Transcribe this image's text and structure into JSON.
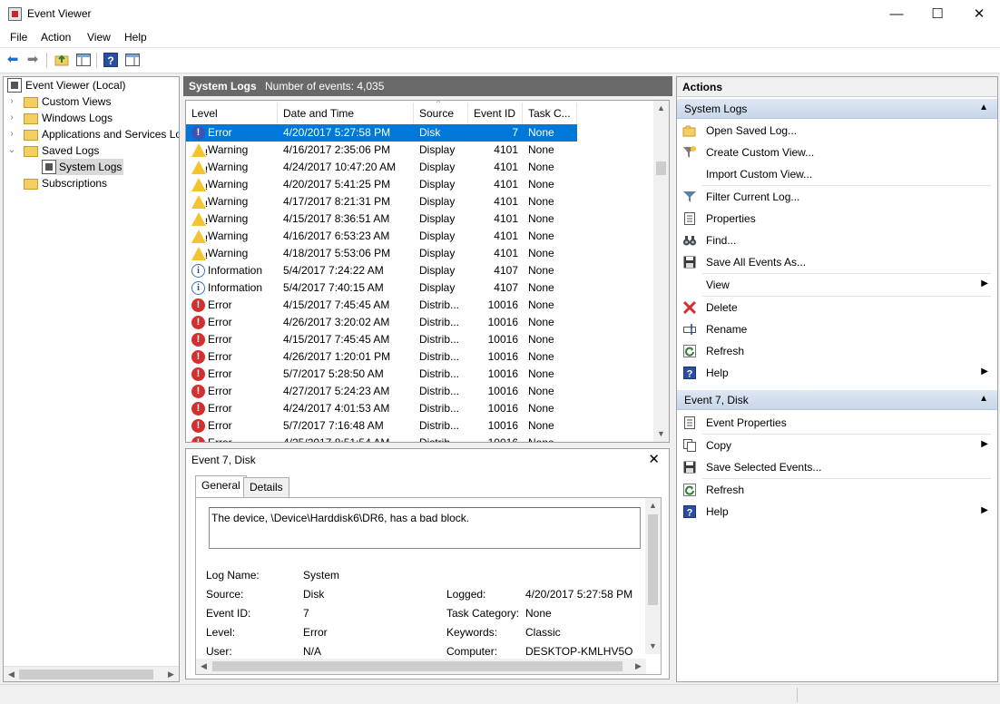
{
  "window": {
    "title": "Event Viewer",
    "minimize_glyph": "—",
    "maximize_glyph": "☐",
    "close_glyph": "✕"
  },
  "menu": [
    "File",
    "Action",
    "View",
    "Help"
  ],
  "toolbar": {
    "icons": [
      "back-arrow-icon",
      "forward-arrow-icon",
      "up-folder-icon",
      "show-hide-tree-icon",
      "help-icon",
      "show-hide-action-pane-icon"
    ]
  },
  "tree": {
    "root": "Event Viewer (Local)",
    "items": [
      {
        "label": "Custom Views"
      },
      {
        "label": "Windows Logs"
      },
      {
        "label": "Applications and Services Lo"
      },
      {
        "label": "Saved Logs"
      },
      {
        "label": "System Logs"
      },
      {
        "label": "Subscriptions"
      }
    ]
  },
  "log_header": {
    "title": "System Logs",
    "count": "Number of events: 4,035"
  },
  "grid": {
    "columns": [
      "Level",
      "Date and Time",
      "Source",
      "Event ID",
      "Task C..."
    ],
    "rows": [
      {
        "level": "Error",
        "date": "4/20/2017 5:27:58 PM",
        "source": "Disk",
        "event_id": "7",
        "task": "None"
      },
      {
        "level": "Warning",
        "date": "4/16/2017 2:35:06 PM",
        "source": "Display",
        "event_id": "4101",
        "task": "None"
      },
      {
        "level": "Warning",
        "date": "4/24/2017 10:47:20 AM",
        "source": "Display",
        "event_id": "4101",
        "task": "None"
      },
      {
        "level": "Warning",
        "date": "4/20/2017 5:41:25 PM",
        "source": "Display",
        "event_id": "4101",
        "task": "None"
      },
      {
        "level": "Warning",
        "date": "4/17/2017 8:21:31 PM",
        "source": "Display",
        "event_id": "4101",
        "task": "None"
      },
      {
        "level": "Warning",
        "date": "4/15/2017 8:36:51 AM",
        "source": "Display",
        "event_id": "4101",
        "task": "None"
      },
      {
        "level": "Warning",
        "date": "4/16/2017 6:53:23 AM",
        "source": "Display",
        "event_id": "4101",
        "task": "None"
      },
      {
        "level": "Warning",
        "date": "4/18/2017 5:53:06 PM",
        "source": "Display",
        "event_id": "4101",
        "task": "None"
      },
      {
        "level": "Information",
        "date": "5/4/2017 7:24:22 AM",
        "source": "Display",
        "event_id": "4107",
        "task": "None"
      },
      {
        "level": "Information",
        "date": "5/4/2017 7:40:15 AM",
        "source": "Display",
        "event_id": "4107",
        "task": "None"
      },
      {
        "level": "Error",
        "date": "4/15/2017 7:45:45 AM",
        "source": "Distrib...",
        "event_id": "10016",
        "task": "None"
      },
      {
        "level": "Error",
        "date": "4/26/2017 3:20:02 AM",
        "source": "Distrib...",
        "event_id": "10016",
        "task": "None"
      },
      {
        "level": "Error",
        "date": "4/15/2017 7:45:45 AM",
        "source": "Distrib...",
        "event_id": "10016",
        "task": "None"
      },
      {
        "level": "Error",
        "date": "4/26/2017 1:20:01 PM",
        "source": "Distrib...",
        "event_id": "10016",
        "task": "None"
      },
      {
        "level": "Error",
        "date": "5/7/2017 5:28:50 AM",
        "source": "Distrib...",
        "event_id": "10016",
        "task": "None"
      },
      {
        "level": "Error",
        "date": "4/27/2017 5:24:23 AM",
        "source": "Distrib...",
        "event_id": "10016",
        "task": "None"
      },
      {
        "level": "Error",
        "date": "4/24/2017 4:01:53 AM",
        "source": "Distrib...",
        "event_id": "10016",
        "task": "None"
      },
      {
        "level": "Error",
        "date": "5/7/2017 7:16:48 AM",
        "source": "Distrib...",
        "event_id": "10016",
        "task": "None"
      },
      {
        "level": "Error",
        "date": "4/25/2017 8:51:54 AM",
        "source": "Distrib...",
        "event_id": "10016",
        "task": "None"
      }
    ]
  },
  "details": {
    "title": "Event 7, Disk",
    "close_glyph": "✕",
    "tabs": [
      "General",
      "Details"
    ],
    "message": "The device, \\Device\\Harddisk6\\DR6, has a bad block.",
    "fields": {
      "log_name_label": "Log Name:",
      "log_name": "System",
      "source_label": "Source:",
      "source": "Disk",
      "logged_label": "Logged:",
      "logged": "4/20/2017 5:27:58 PM",
      "event_id_label": "Event ID:",
      "event_id": "7",
      "task_category_label": "Task Category:",
      "task_category": "None",
      "level_label": "Level:",
      "level": "Error",
      "keywords_label": "Keywords:",
      "keywords": "Classic",
      "user_label": "User:",
      "user": "N/A",
      "computer_label": "Computer:",
      "computer": "DESKTOP-KMLHV5O"
    }
  },
  "actions": {
    "title": "Actions",
    "section1": "System Logs",
    "items1": [
      {
        "label": "Open Saved Log...",
        "icon": "open-folder-icon"
      },
      {
        "label": "Create Custom View...",
        "icon": "filter-create-icon"
      },
      {
        "label": "Import Custom View...",
        "icon": ""
      },
      {
        "label": "Filter Current Log...",
        "icon": "filter-icon"
      },
      {
        "label": "Properties",
        "icon": "properties-icon"
      },
      {
        "label": "Find...",
        "icon": "find-binoculars-icon"
      },
      {
        "label": "Save All Events As...",
        "icon": "save-icon"
      },
      {
        "label": "View",
        "icon": "",
        "submenu": true
      },
      {
        "label": "Delete",
        "icon": "delete-icon"
      },
      {
        "label": "Rename",
        "icon": "rename-icon"
      },
      {
        "label": "Refresh",
        "icon": "refresh-icon"
      },
      {
        "label": "Help",
        "icon": "help-icon",
        "submenu": true
      }
    ],
    "section2": "Event 7, Disk",
    "items2": [
      {
        "label": "Event Properties",
        "icon": "event-properties-icon"
      },
      {
        "label": "Copy",
        "icon": "copy-icon",
        "submenu": true
      },
      {
        "label": "Save Selected Events...",
        "icon": "save-icon"
      },
      {
        "label": "Refresh",
        "icon": "refresh-icon"
      },
      {
        "label": "Help",
        "icon": "help-icon",
        "submenu": true
      }
    ]
  },
  "colors": {
    "selection": "#0078d7",
    "error": "#d32f2f",
    "warning": "#f4c430",
    "info": "#3e6fb5",
    "log_header_bg": "#696969",
    "section_header_bg": "#c7d6ea"
  }
}
